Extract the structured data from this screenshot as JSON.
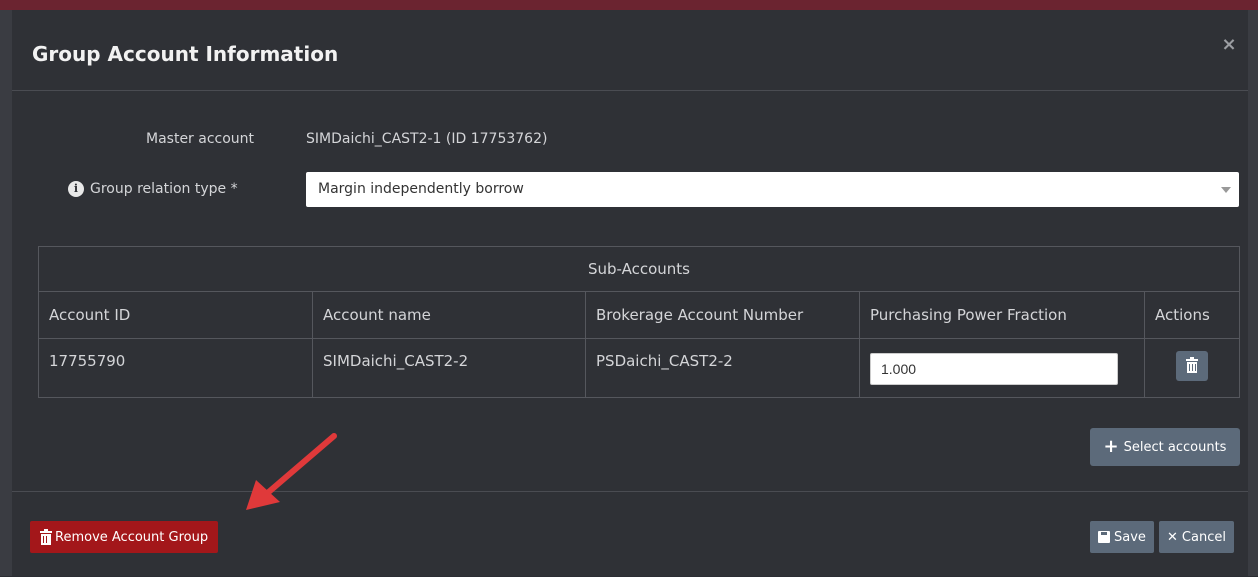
{
  "modal": {
    "title": "Group Account Information",
    "close_label": "×"
  },
  "form": {
    "master_label": "Master account",
    "master_value": "SIMDaichi_CAST2-1 (ID 17753762)",
    "relation_label": "Group relation type  *",
    "relation_value": "Margin independently borrow",
    "info_icon": "i"
  },
  "sub_accounts": {
    "group_header": "Sub-Accounts",
    "columns": [
      "Account ID",
      "Account name",
      "Brokerage Account Number",
      "Purchasing Power Fraction",
      "Actions"
    ],
    "rows": [
      {
        "account_id": "17755790",
        "account_name": "SIMDaichi_CAST2-2",
        "brokerage_number": "PSDaichi_CAST2-2",
        "pp_fraction": "1.000"
      }
    ],
    "select_accounts_label": "Select accounts"
  },
  "footer": {
    "remove_label": "Remove Account Group",
    "save_label": "Save",
    "cancel_label": "Cancel"
  },
  "colors": {
    "modal_bg": "#2f3136",
    "accent_gray": "#5c6a7a",
    "danger": "#a3171a",
    "arrow": "#e0393a"
  },
  "icons": [
    "close-icon",
    "info-icon",
    "trash-icon",
    "plus-icon",
    "save-icon",
    "times-icon",
    "arrow-annotation"
  ]
}
